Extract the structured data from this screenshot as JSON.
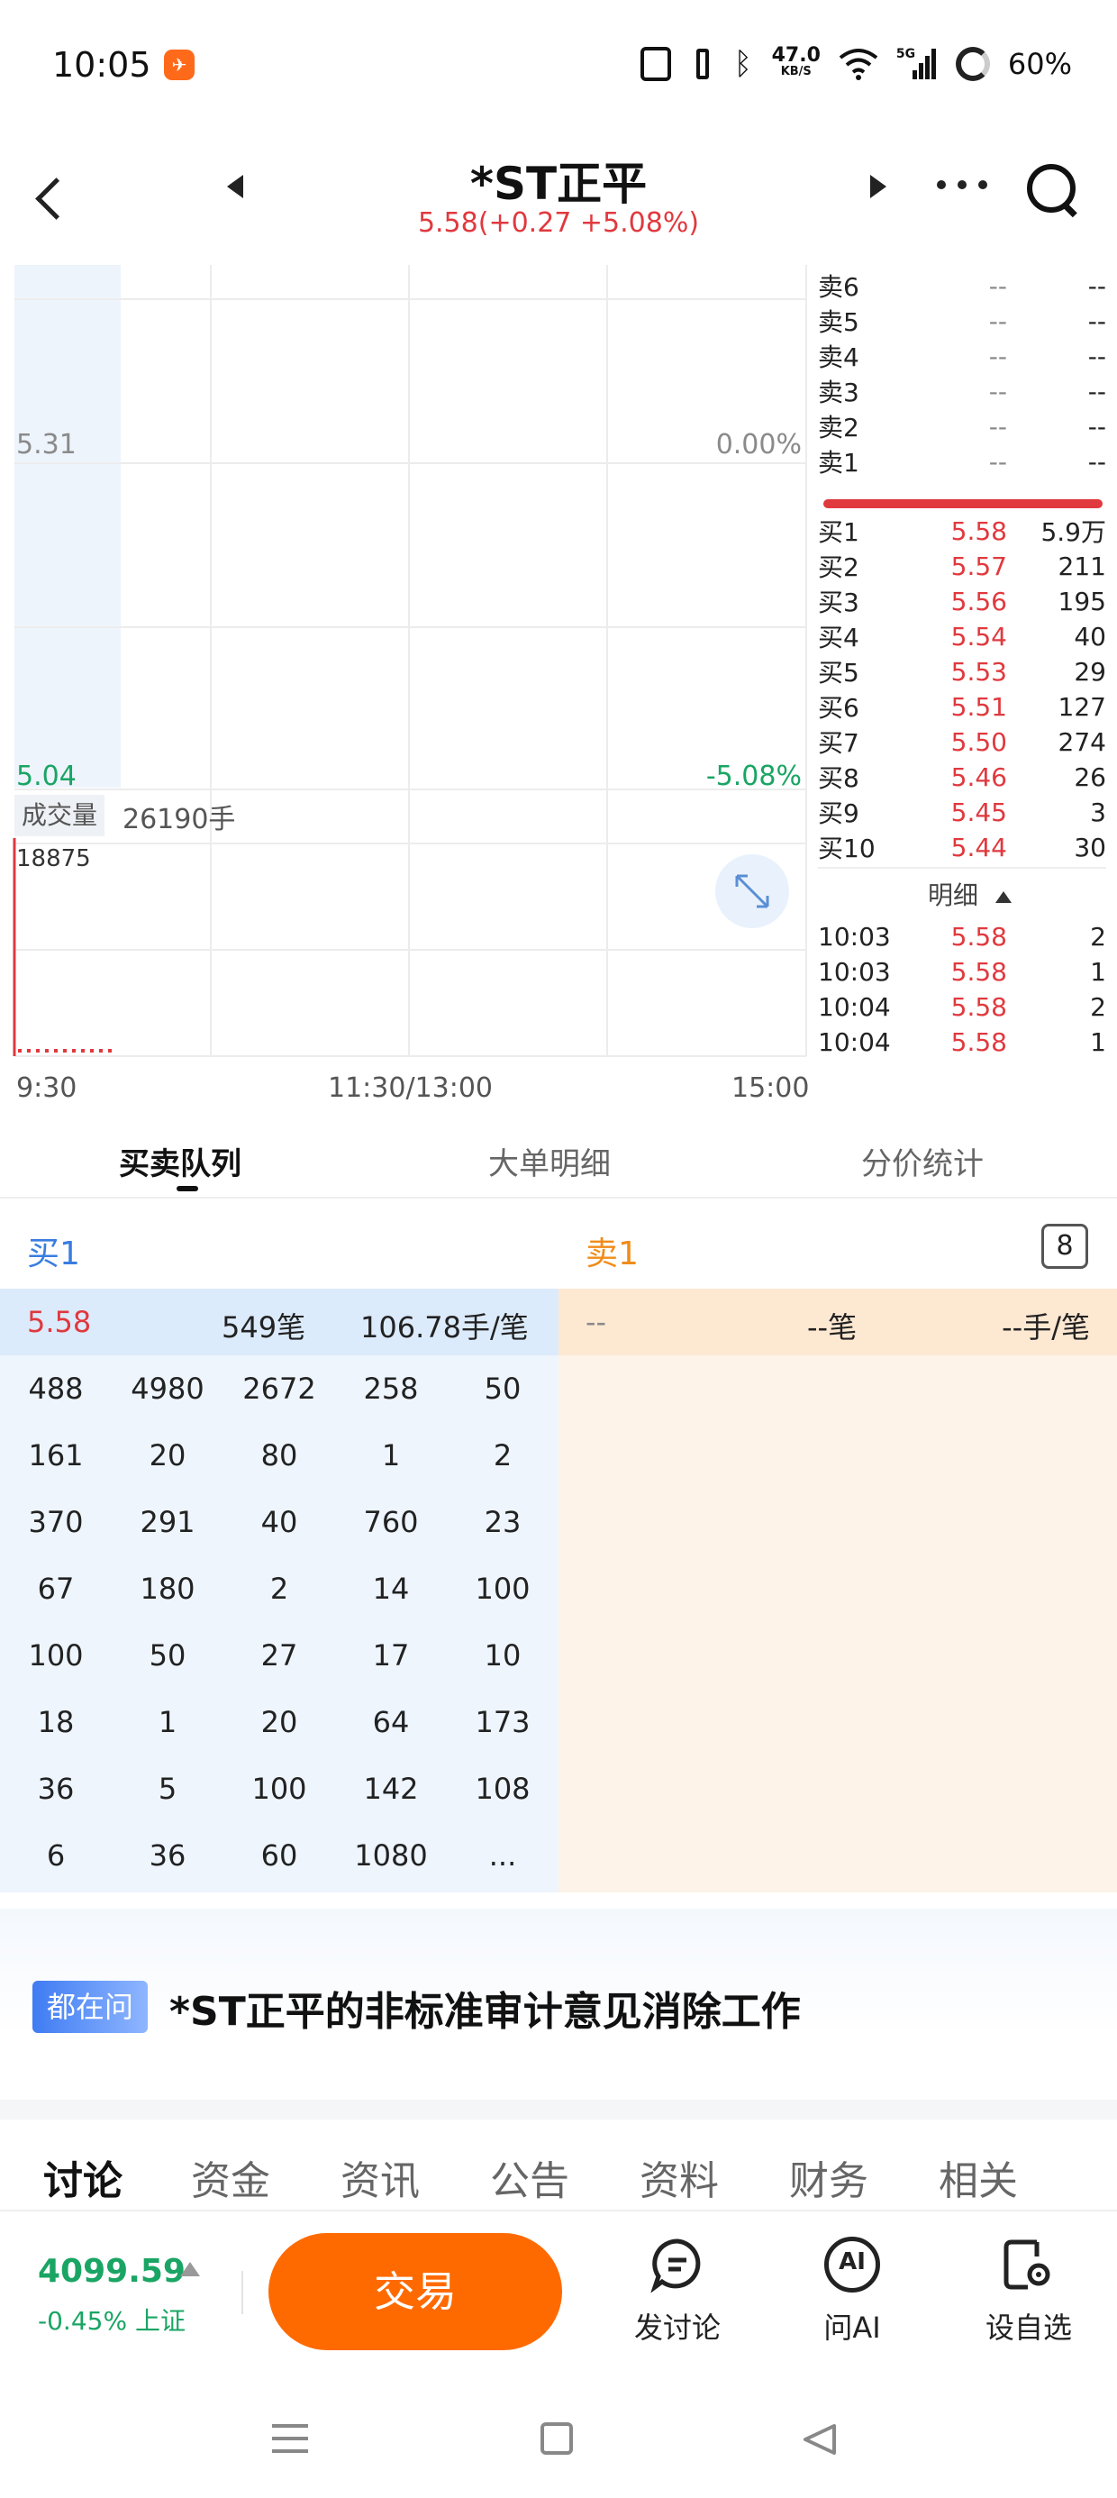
{
  "status_bar": {
    "time": "10:05",
    "net_speed_value": "47.0",
    "net_speed_unit": "KB/S",
    "signal_label": "5G",
    "battery": "60%"
  },
  "header": {
    "stock_name": "*ST正平",
    "quote": "5.58(+0.27 +5.08%)"
  },
  "chart": {
    "price_high": "5.31",
    "pct_high": "0.00%",
    "price_low": "5.04",
    "pct_low": "-5.08%",
    "volume_label": "成交量",
    "volume_value": "26190手",
    "volume_max": "18875",
    "time_start": "9:30",
    "time_mid": "11:30/13:00",
    "time_end": "15:00"
  },
  "orderbook": {
    "sells": [
      {
        "label": "卖6",
        "price": "--",
        "vol": "--"
      },
      {
        "label": "卖5",
        "price": "--",
        "vol": "--"
      },
      {
        "label": "卖4",
        "price": "--",
        "vol": "--"
      },
      {
        "label": "卖3",
        "price": "--",
        "vol": "--"
      },
      {
        "label": "卖2",
        "price": "--",
        "vol": "--"
      },
      {
        "label": "卖1",
        "price": "--",
        "vol": "--"
      }
    ],
    "buys": [
      {
        "label": "买1",
        "price": "5.58",
        "vol": "5.9万"
      },
      {
        "label": "买2",
        "price": "5.57",
        "vol": "211"
      },
      {
        "label": "买3",
        "price": "5.56",
        "vol": "195"
      },
      {
        "label": "买4",
        "price": "5.54",
        "vol": "40"
      },
      {
        "label": "买5",
        "price": "5.53",
        "vol": "29"
      },
      {
        "label": "买6",
        "price": "5.51",
        "vol": "127"
      },
      {
        "label": "买7",
        "price": "5.50",
        "vol": "274"
      },
      {
        "label": "买8",
        "price": "5.46",
        "vol": "26"
      },
      {
        "label": "买9",
        "price": "5.45",
        "vol": "3"
      },
      {
        "label": "买10",
        "price": "5.44",
        "vol": "30"
      }
    ],
    "detail_title": "明细",
    "ticks": [
      {
        "time": "10:03",
        "price": "5.58",
        "vol": "2"
      },
      {
        "time": "10:03",
        "price": "5.58",
        "vol": "1"
      },
      {
        "time": "10:04",
        "price": "5.58",
        "vol": "2"
      },
      {
        "time": "10:04",
        "price": "5.58",
        "vol": "1"
      }
    ]
  },
  "tabs": [
    "买卖队列",
    "大单明细",
    "分价统计"
  ],
  "queue": {
    "buy_title": "买1",
    "sell_title": "卖1",
    "badge": "8",
    "buy_header": {
      "price": "5.58",
      "count": "549笔",
      "avg": "106.78手/笔"
    },
    "sell_header": {
      "price": "--",
      "count": "--笔",
      "avg": "--手/笔"
    },
    "buy_rows": [
      [
        "488",
        "4980",
        "2672",
        "258",
        "50"
      ],
      [
        "161",
        "20",
        "80",
        "1",
        "2"
      ],
      [
        "370",
        "291",
        "40",
        "760",
        "23"
      ],
      [
        "67",
        "180",
        "2",
        "14",
        "100"
      ],
      [
        "100",
        "50",
        "27",
        "17",
        "10"
      ],
      [
        "18",
        "1",
        "20",
        "64",
        "173"
      ],
      [
        "36",
        "5",
        "100",
        "142",
        "108"
      ],
      [
        "6",
        "36",
        "60",
        "1080",
        "..."
      ]
    ]
  },
  "ask": {
    "badge": "都在问",
    "text": "*ST正平的非标准审计意见消除工作"
  },
  "content_tabs": [
    "讨论",
    "资金",
    "资讯",
    "公告",
    "资料",
    "财务",
    "相关"
  ],
  "bottom": {
    "index_value": "4099.59",
    "index_change": "-0.45% 上证",
    "trade_label": "交易",
    "actions": [
      "发讨论",
      "问AI",
      "设自选"
    ],
    "ai_icon_text": "AI"
  },
  "colors": {
    "up": "#e0393e",
    "down": "#1aa564",
    "accent": "#ff6a00",
    "sell_title": "#f08c1a",
    "buy_title": "#3a7de0"
  }
}
